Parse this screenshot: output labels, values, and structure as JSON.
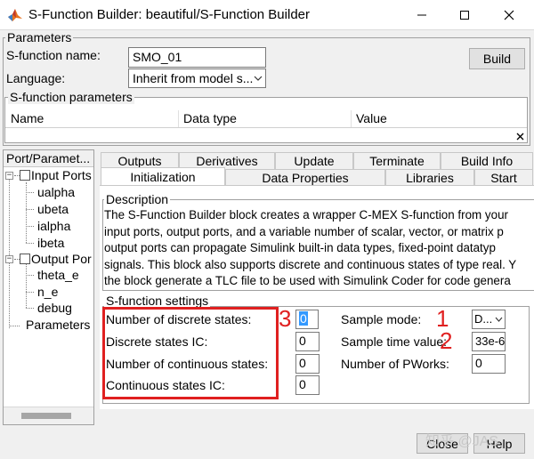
{
  "window": {
    "title": "S-Function Builder: beautiful/S-Function Builder"
  },
  "parameters": {
    "legend": "Parameters",
    "sfunction_name_label": "S-function name:",
    "sfunction_name_value": "SMO_01",
    "language_label": "Language:",
    "language_value": "Inherit from model s...",
    "build_label": "Build",
    "sfunction_params_legend": "S-function parameters",
    "columns": [
      "Name",
      "Data type",
      "Value"
    ]
  },
  "port_panel": {
    "title": "Port/Paramet...",
    "input_ports_label": "Input Ports",
    "input_ports": [
      "ualpha",
      "ubeta",
      "ialpha",
      "ibeta"
    ],
    "output_ports_label": "Output Por",
    "output_ports": [
      "theta_e",
      "n_e",
      "debug"
    ],
    "parameters_label": "Parameters"
  },
  "tabs": {
    "row1": [
      "Outputs",
      "Derivatives",
      "Update",
      "Terminate",
      "Build Info"
    ],
    "row2": [
      "Initialization",
      "Data Properties",
      "Libraries",
      "Start"
    ],
    "active": "Initialization"
  },
  "description": {
    "legend": "Description",
    "lines": [
      "The S-Function Builder block creates a wrapper C-MEX S-function from your",
      "input ports, output ports, and a variable number of scalar, vector, or matrix p",
      "output ports can propagate Simulink built-in data types, fixed-point datatyp",
      "signals. This block also supports discrete and continuous states of type real. Y",
      "the block generate a TLC file to be used with Simulink Coder for code genera"
    ]
  },
  "settings": {
    "legend": "S-function settings",
    "num_discrete_states_label": "Number of discrete states:",
    "num_discrete_states_value": "0",
    "discrete_ic_label": "Discrete states IC:",
    "discrete_ic_value": "0",
    "num_continuous_states_label": "Number of continuous states:",
    "num_continuous_states_value": "0",
    "continuous_ic_label": "Continuous states IC:",
    "continuous_ic_value": "0",
    "sample_mode_label": "Sample mode:",
    "sample_mode_value": "D...",
    "sample_time_label": "Sample time value:",
    "sample_time_value": "33e-6",
    "num_pworks_label": "Number of PWorks:",
    "num_pworks_value": "0"
  },
  "annotations": {
    "n1": "1",
    "n2": "2",
    "n3": "3",
    "color": "#e02020"
  },
  "footer": {
    "close_label": "Close",
    "help_label": "Help",
    "watermark": "知乎 @JAS"
  }
}
